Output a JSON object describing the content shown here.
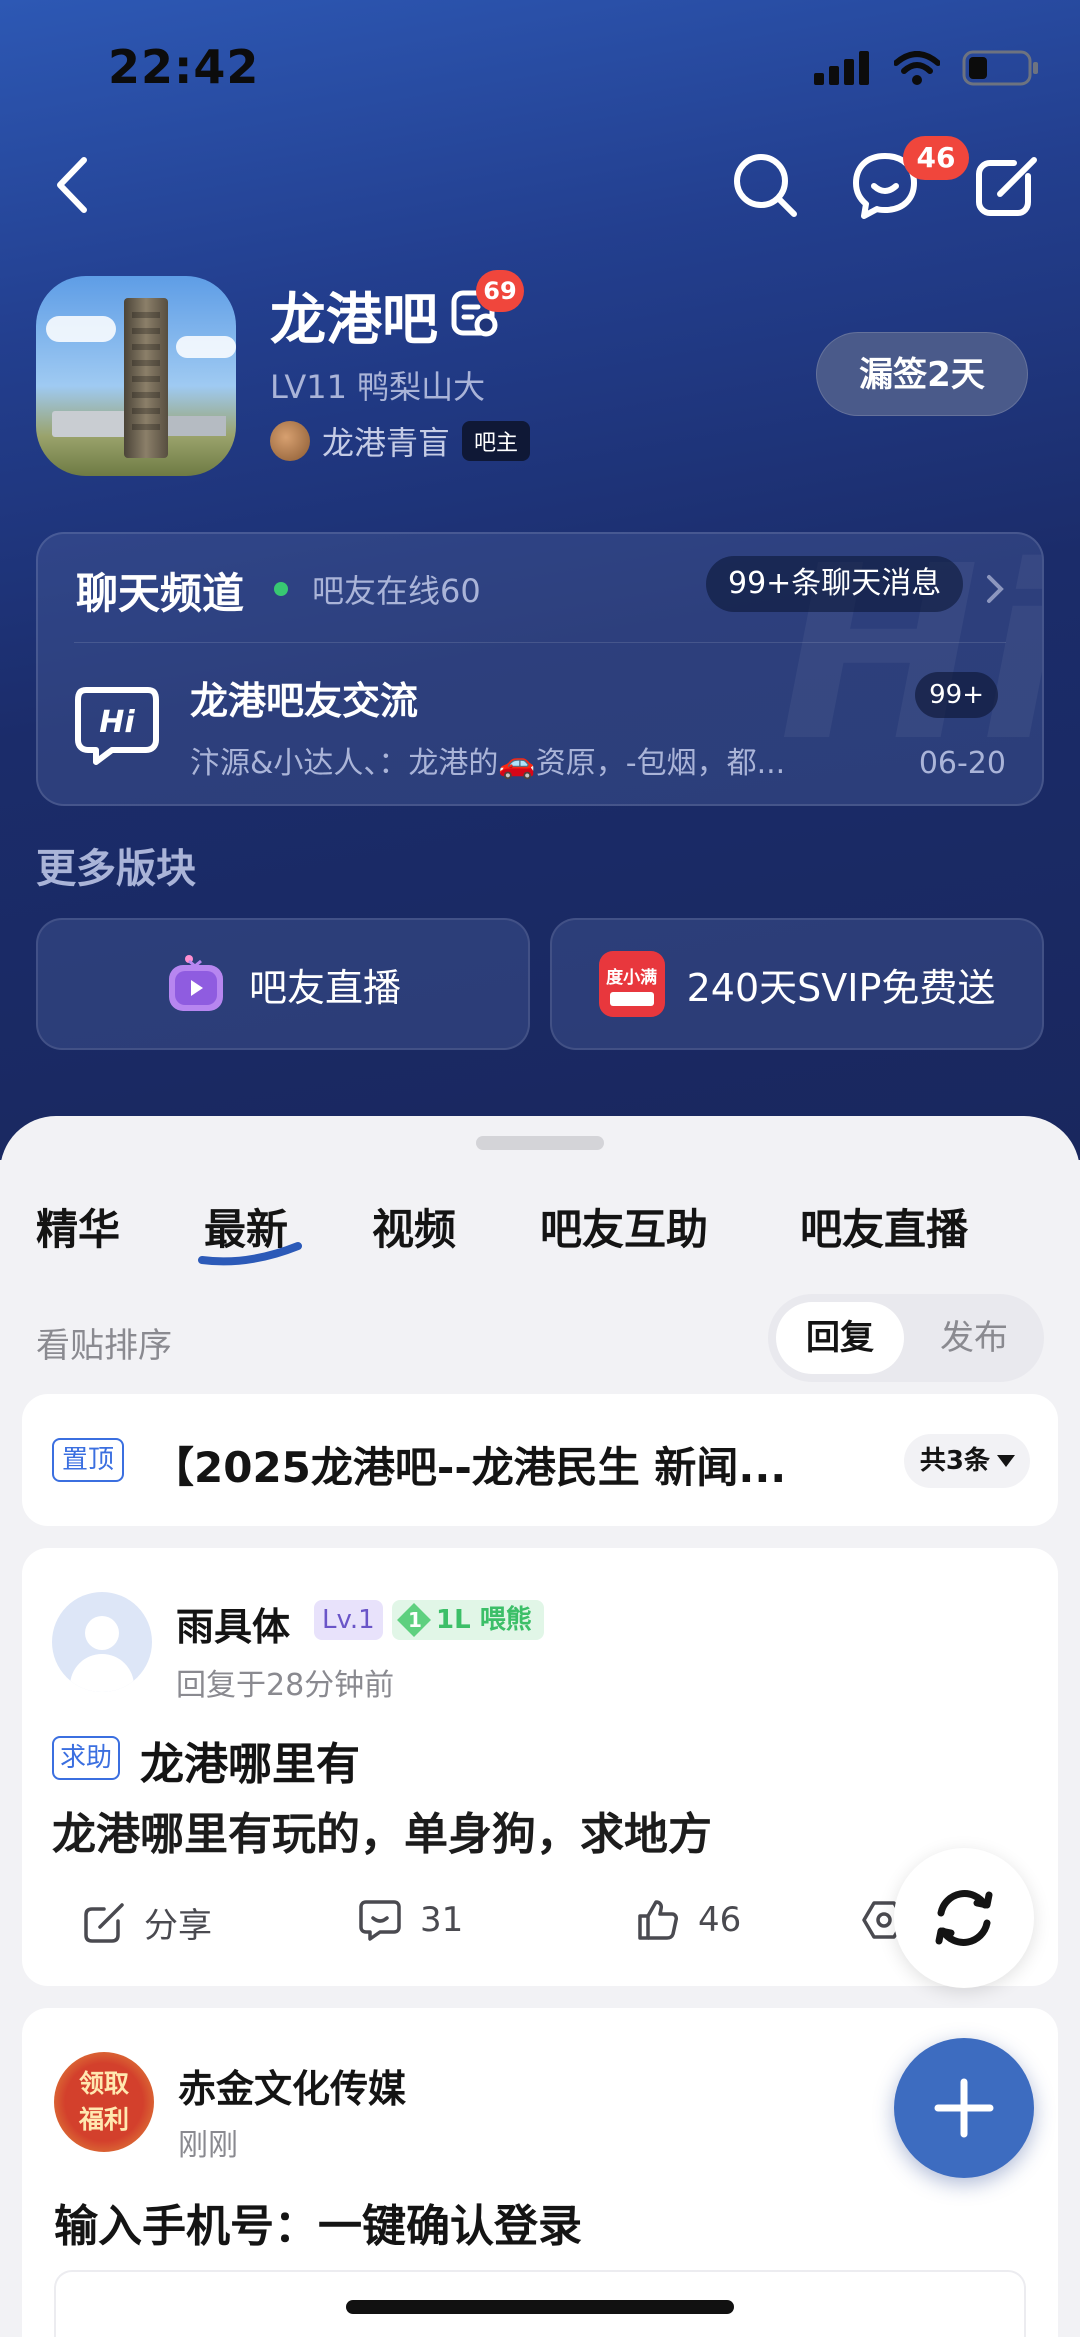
{
  "status_bar": {
    "time": "22:42"
  },
  "nav": {
    "message_badge": "46"
  },
  "forum": {
    "name": "龙港吧",
    "icon_badge": "69",
    "level_text": "LV11 鸭梨山大",
    "owner_name": "龙港青盲",
    "owner_tag": "吧主",
    "checkin_label": "漏签2天"
  },
  "chat": {
    "title": "聊天频道",
    "online_text": "吧友在线60",
    "message_count": "99+条聊天消息",
    "room_name": "龙港吧友交流",
    "room_preview": "汴源&小达人、：龙港的🚗资原，-包烟，都...",
    "room_unread": "99+",
    "room_date": "06-20",
    "watermark": "Hi"
  },
  "more_sections": {
    "title": "更多版块",
    "items": [
      {
        "label": "吧友直播",
        "icon": "live-tv-icon"
      },
      {
        "label": "240天SVIP免费送",
        "icon": "duxiaoman-icon",
        "icon_text": "度小满"
      }
    ]
  },
  "tabs": [
    {
      "label": "精华"
    },
    {
      "label": "最新",
      "active": true
    },
    {
      "label": "视频"
    },
    {
      "label": "吧友互助"
    },
    {
      "label": "吧友直播"
    }
  ],
  "sort": {
    "label": "看贴排序",
    "options": [
      "回复",
      "发布"
    ],
    "selected": "回复"
  },
  "pinned": {
    "tag": "置顶",
    "title": "【2025龙港吧--龙港民生 新闻...",
    "count": "共3条"
  },
  "post": {
    "user": "雨具体",
    "level": "Lv.1",
    "fan_level": "1",
    "fan_label": "1L 喂熊",
    "time": "回复于28分钟前",
    "tag": "求助",
    "title": "龙港哪里有",
    "body": "龙港哪里有玩的，单身狗，求地方",
    "share_label": "分享",
    "comment_count": "31",
    "like_count": "46"
  },
  "ad": {
    "logo_text_line1": "领取",
    "logo_text_line2": "福利",
    "name": "赤金文化传媒",
    "time": "刚刚",
    "title": "输入手机号：一键确认登录"
  },
  "colors": {
    "accent": "#3d6cc0",
    "badge": "#f0463c",
    "header_top": "#2d58b4",
    "header_bottom": "#19275e"
  }
}
